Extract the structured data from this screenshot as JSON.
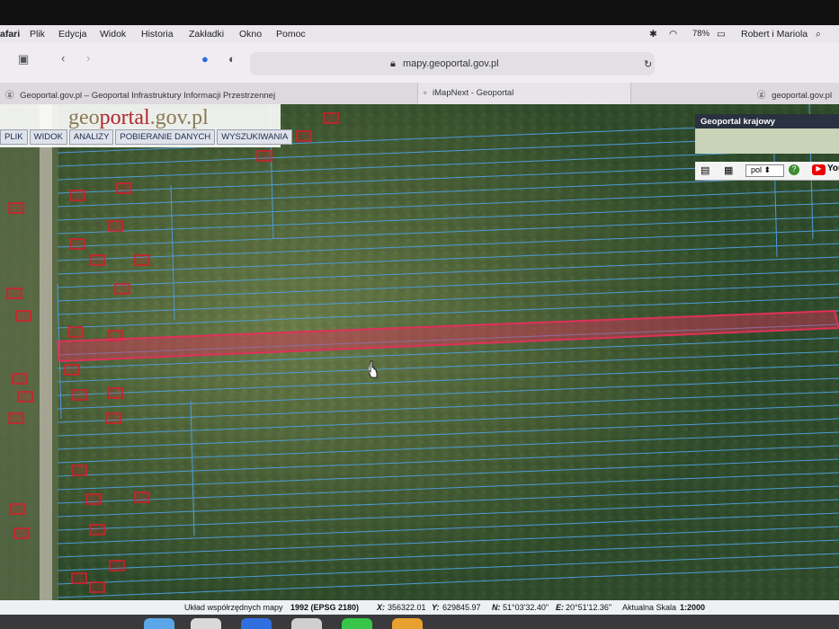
{
  "menubar": {
    "app": "afari",
    "items": [
      "Plik",
      "Edycja",
      "Widok",
      "Historia",
      "Zakładki",
      "Okno",
      "Pomoc"
    ],
    "battery": "78%",
    "user": "Robert i Mariola"
  },
  "browser": {
    "url": "mapy.geoportal.gov.pl",
    "tabs": [
      "Geoportal.gov.pl – Geoportal Infrastruktury Informacji Przestrzennej",
      "iMapNext - Geoportal",
      "geoportal.gov.pl"
    ]
  },
  "geoportal": {
    "logo": {
      "pre": "geo",
      "mid": "portal",
      "post": ".gov.pl"
    },
    "menu": [
      "PLIK",
      "WIDOK",
      "ANALIZY",
      "POBIERANIE DANYCH",
      "WYSZUKIWANIA"
    ],
    "krajowy": "Geoportal krajowy",
    "language": "pol",
    "youtube": "YouTube"
  },
  "status": {
    "label": "Układ współrzędnych mapy",
    "crs": "1992 (EPSG 2180)",
    "x_label": "X:",
    "x": "356322.01",
    "y_label": "Y:",
    "y": "629845.97",
    "n_label": "N:",
    "n": "51°03'32.40\"",
    "e_label": "E:",
    "e": "20°51'12.36\"",
    "scale_label": "Aktualna Skala",
    "scale": "1:2000"
  },
  "colors": {
    "parcel_line": "#4f9bd8",
    "building": "#d81c2a",
    "highlight": "#e0305a"
  }
}
